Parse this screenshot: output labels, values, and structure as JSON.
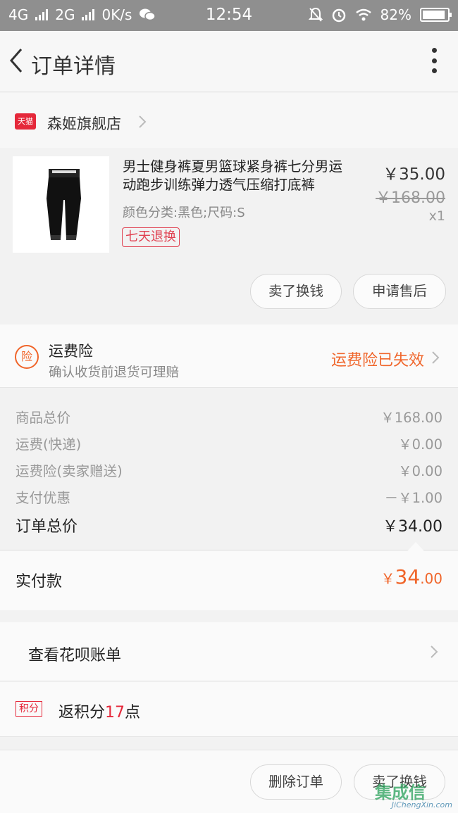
{
  "status_bar": {
    "network_1": "4G",
    "network_2": "2G",
    "speed": "0K/s",
    "time": "12:54",
    "battery": "82%",
    "battery_level": 0.82
  },
  "nav": {
    "title": "订单详情"
  },
  "shop": {
    "platform_badge": "天猫",
    "name": "森姬旗舰店"
  },
  "item": {
    "title": "男士健身裤夏男篮球紧身裤七分男运动跑步训练弹力透气压缩打底裤",
    "sku": "颜色分类:黑色;尺码:S",
    "tag": "七天退换",
    "price": "￥35.00",
    "original_price": "￥168.00",
    "quantity": "x1",
    "buttons": [
      "卖了换钱",
      "申请售后"
    ]
  },
  "insurance": {
    "badge": "险",
    "title": "运费险",
    "subtitle": "确认收货前退货可理赔",
    "status": "运费险已失效"
  },
  "costs": {
    "rows": [
      {
        "label": "商品总价",
        "value": "￥168.00"
      },
      {
        "label": "运费(快递)",
        "value": "￥0.00"
      },
      {
        "label": "运费险(卖家赠送)",
        "value": "￥0.00"
      },
      {
        "label": "支付优惠",
        "value": "－￥1.00"
      }
    ],
    "total_label": "订单总价",
    "total_value": "￥34.00"
  },
  "paid": {
    "label": "实付款",
    "currency": "￥",
    "integer": "34",
    "decimal": ".00"
  },
  "huabei": {
    "label": "查看花呗账单"
  },
  "points": {
    "badge": "积分",
    "prefix": "返积分",
    "count": "17",
    "suffix": "点"
  },
  "bottom_bar": {
    "buttons": [
      "删除订单",
      "卖了换钱"
    ]
  },
  "watermark": {
    "text_cn": "集成信",
    "text_en": "JiChengXin.com"
  },
  "colors": {
    "accent_orange": "#f0652a",
    "tmall_red": "#e5283a",
    "status_bar": "#8f8f8f"
  }
}
